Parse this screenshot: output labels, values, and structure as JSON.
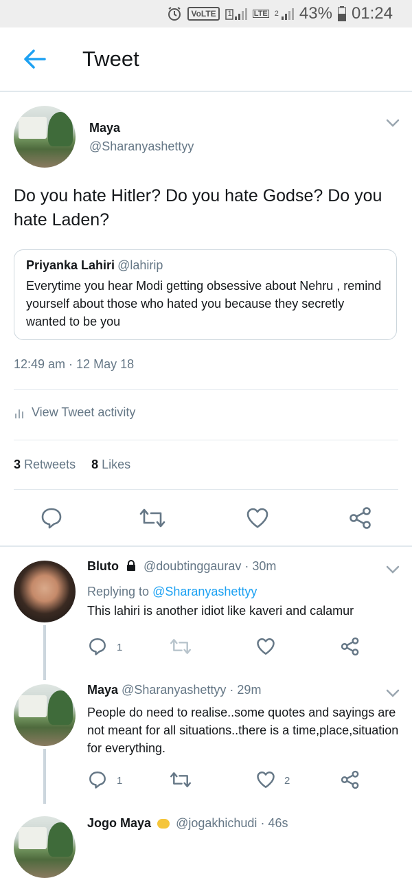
{
  "status_bar": {
    "volte": "VoLTE",
    "sim1": "1",
    "lte": "LTE",
    "sim2": "2",
    "battery": "43%",
    "time": "01:24"
  },
  "app_bar": {
    "title": "Tweet"
  },
  "main_tweet": {
    "name": "Maya",
    "handle": "@Sharanyashettyy",
    "text": "Do you hate Hitler? Do you hate Godse? Do you hate Laden?",
    "quote": {
      "name": "Priyanka Lahiri",
      "handle": "@lahirip",
      "text": "Everytime you hear Modi getting obsessive about Nehru , remind yourself about those who hated you because they secretly wanted to be you"
    },
    "timestamp": "12:49 am · 12 May 18",
    "view_activity": "View Tweet activity",
    "retweets_count": "3",
    "retweets_label": "Retweets",
    "likes_count": "8",
    "likes_label": "Likes"
  },
  "replies": [
    {
      "name": "Bluto",
      "handle": "@doubtinggaurav",
      "time": "· 30m",
      "replying_label": "Replying to",
      "replying_to": "@Sharanyashettyy",
      "text": "This lahiri is another idiot like kaveri and calamur",
      "reply_count": "1",
      "like_count": ""
    },
    {
      "name": "Maya",
      "handle": "@Sharanyashettyy",
      "time": "· 29m",
      "text": "People do need to realise..some quotes and sayings are not meant for all situations..there is a time,place,situation for everything.",
      "reply_count": "1",
      "like_count": "2"
    },
    {
      "name": "Jogo Maya",
      "handle": "@jogakhichudi",
      "time": "· 46s"
    }
  ],
  "colors": {
    "accent": "#1da1f2",
    "muted": "#657786",
    "border": "#e1e8ed"
  }
}
